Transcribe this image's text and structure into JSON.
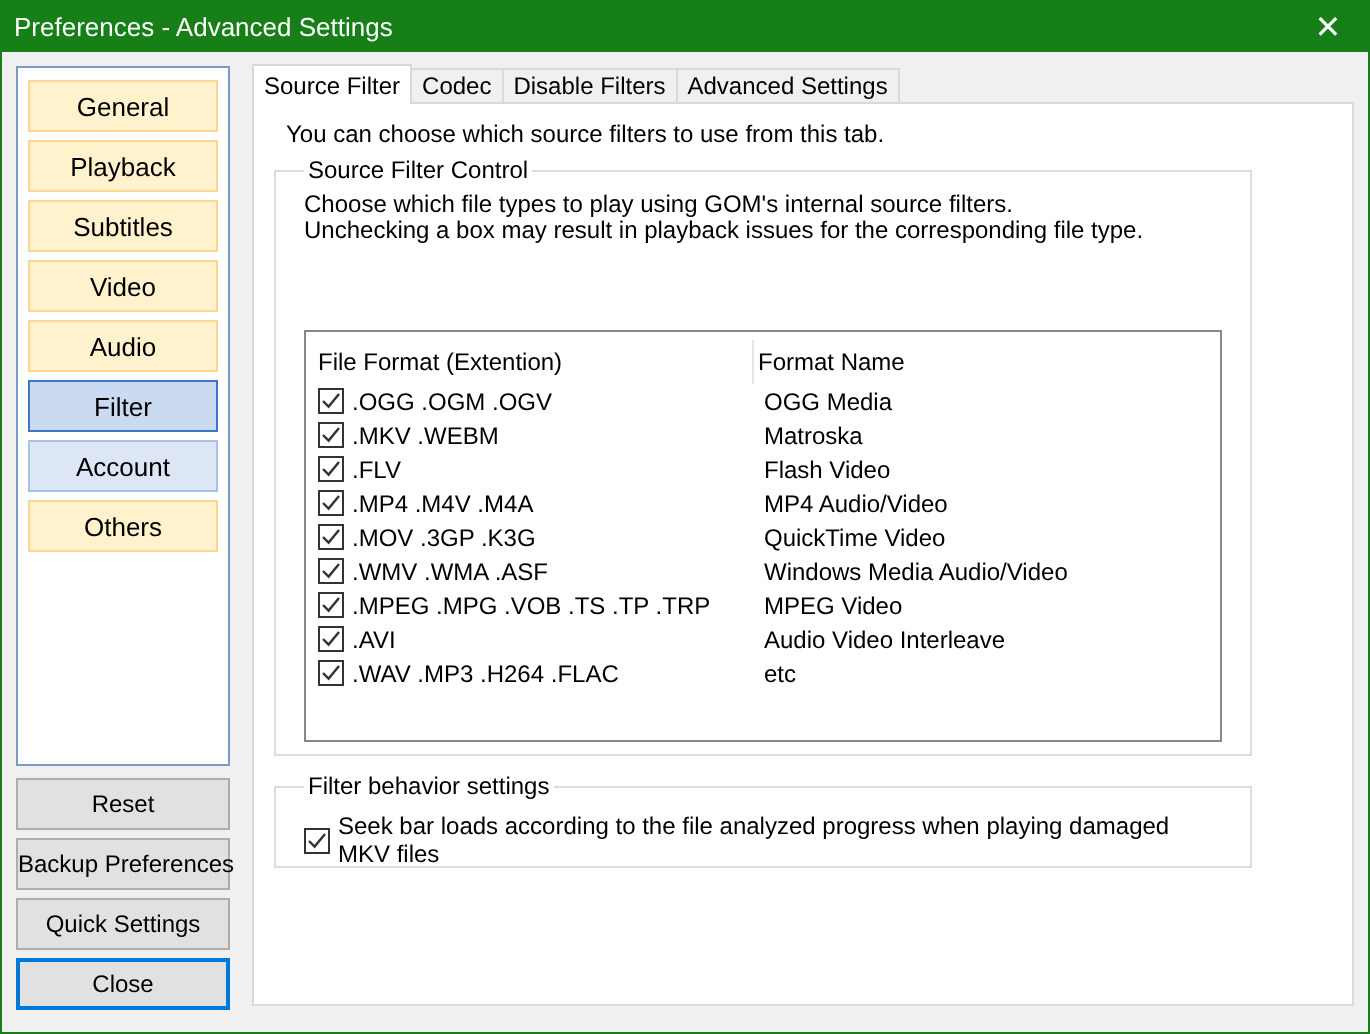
{
  "window": {
    "title": "Preferences - Advanced Settings",
    "close": "✕"
  },
  "sidebar": {
    "items": [
      {
        "label": "General",
        "selected": false,
        "hovered": false
      },
      {
        "label": "Playback",
        "selected": false,
        "hovered": false
      },
      {
        "label": "Subtitles",
        "selected": false,
        "hovered": false
      },
      {
        "label": "Video",
        "selected": false,
        "hovered": false
      },
      {
        "label": "Audio",
        "selected": false,
        "hovered": false
      },
      {
        "label": "Filter",
        "selected": true,
        "hovered": false
      },
      {
        "label": "Account",
        "selected": false,
        "hovered": true
      },
      {
        "label": "Others",
        "selected": false,
        "hovered": false
      }
    ]
  },
  "buttons": [
    {
      "label": "Reset",
      "default": false
    },
    {
      "label": "Backup Preferences",
      "default": false
    },
    {
      "label": "Quick Settings",
      "default": false
    },
    {
      "label": "Close",
      "default": true
    }
  ],
  "tabs": [
    {
      "label": "Source Filter",
      "selected": true
    },
    {
      "label": "Codec",
      "selected": false
    },
    {
      "label": "Disable Filters",
      "selected": false
    },
    {
      "label": "Advanced Settings",
      "selected": false
    }
  ],
  "intro": "You can choose which source filters to use from this tab.",
  "source_group": {
    "title": "Source Filter Control",
    "description": [
      "Choose which file types to play using GOM's internal source filters.",
      "Unchecking a box may result in playback issues for the corresponding file type."
    ],
    "table": {
      "columns": [
        "File Format (Extention)",
        "Format Name"
      ],
      "rows": [
        {
          "format": ".OGG .OGM .OGV",
          "name": "OGG Media",
          "checked": true
        },
        {
          "format": ".MKV .WEBM",
          "name": "Matroska",
          "checked": true
        },
        {
          "format": ".FLV",
          "name": "Flash Video",
          "checked": true
        },
        {
          "format": ".MP4 .M4V .M4A",
          "name": "MP4 Audio/Video",
          "checked": true
        },
        {
          "format": ".MOV .3GP .K3G",
          "name": "QuickTime Video",
          "checked": true
        },
        {
          "format": ".WMV .WMA .ASF",
          "name": "Windows Media Audio/Video",
          "checked": true
        },
        {
          "format": ".MPEG .MPG .VOB .TS .TP .TRP",
          "name": "MPEG Video",
          "checked": true
        },
        {
          "format": ".AVI",
          "name": "Audio Video Interleave",
          "checked": true
        },
        {
          "format": ".WAV .MP3 .H264 .FLAC",
          "name": "etc",
          "checked": true
        }
      ]
    }
  },
  "behavior_group": {
    "title": "Filter behavior settings",
    "option": {
      "label": "Seek bar loads according to the file analyzed progress when playing damaged MKV files",
      "checked": true
    }
  }
}
